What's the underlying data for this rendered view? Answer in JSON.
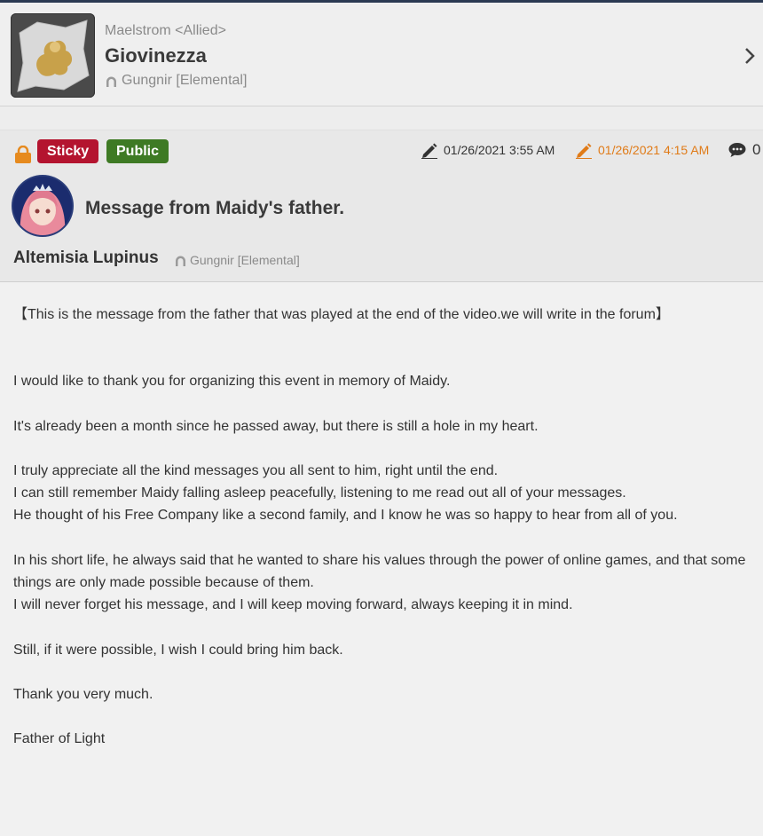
{
  "fc": {
    "tag": "Maelstrom <Allied>",
    "name": "Giovinezza",
    "world": "Gungnir [Elemental]"
  },
  "post": {
    "badges": {
      "sticky": "Sticky",
      "public": "Public"
    },
    "created": "01/26/2021 3:55 AM",
    "edited": "01/26/2021 4:15 AM",
    "comment_count": "0",
    "title": "Message from Maidy's father.",
    "author": "Altemisia Lupinus",
    "author_world": "Gungnir [Elemental]",
    "body": {
      "intro": "【This is the message from the father that was played at the end of the video.we will write in the forum】",
      "p1": "I would like to thank you for organizing this event in memory of Maidy.",
      "p2": "It's already been a month since he passed away, but there is still a hole in my heart.",
      "p3a": "I truly appreciate all the kind messages you all sent to him, right until the end.",
      "p3b": "I can still remember Maidy falling asleep peacefully, listening to me read out all of your messages.",
      "p3c": "He thought of his Free Company like a second family, and I know he was so happy to hear from all of you.",
      "p4a": "In his short life, he always said that he wanted to share his values through the power of online games, and that some things are only made possible because of them.",
      "p4b": "I will never forget his message, and I will keep moving forward, always keeping it in mind.",
      "p5": "Still, if it were possible, I wish I could bring him back.",
      "p6": "Thank you very much.",
      "p7": "Father of Light"
    }
  },
  "colors": {
    "sticky": "#b4142f",
    "public": "#3e7a24",
    "edited": "#e07b18",
    "lock": "#e68a1e"
  },
  "icons": [
    "crest-emblem",
    "world-icon",
    "chevron-right-icon",
    "lock-icon",
    "pencil-icon",
    "pencil-edit-icon",
    "comment-icon"
  ]
}
